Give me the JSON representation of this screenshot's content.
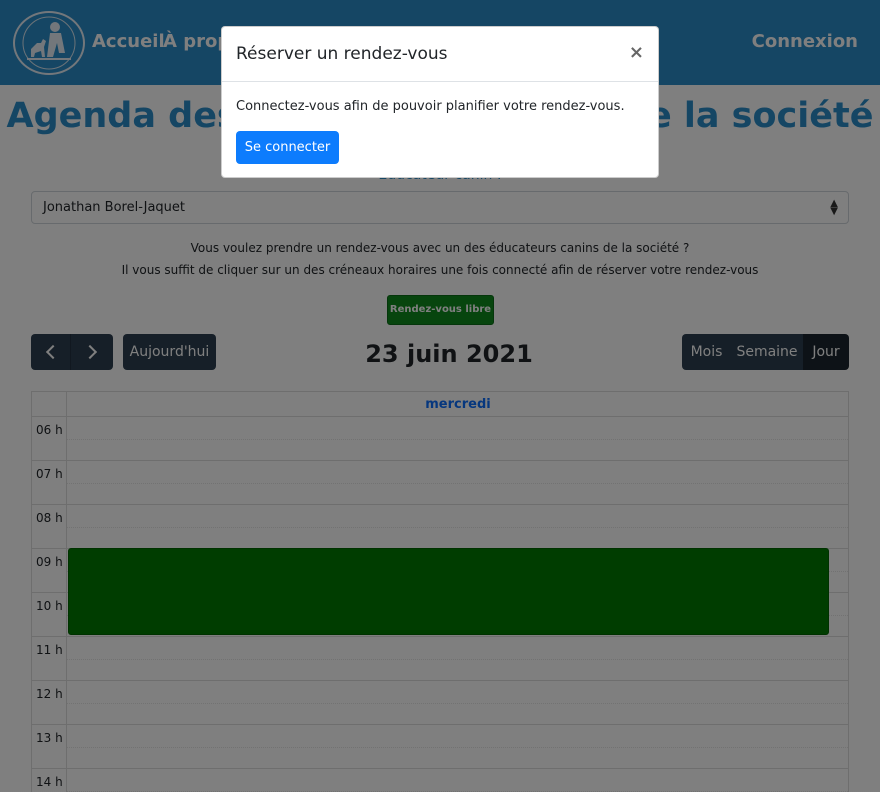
{
  "navbar": {
    "logo_icon": "dog-trainer-logo-icon",
    "links": [
      "Accueil",
      "À propos"
    ],
    "login": "Connexion"
  },
  "page": {
    "title": "Agenda des éducateurs canins de la société",
    "select_label": "Educateur canin :",
    "selected_educator": "Jonathan Borel-Jaquet",
    "info_line1": "Vous voulez prendre un rendez-vous avec un des éducateurs canins de la société ?",
    "info_line2": "Il vous suffit de cliquer sur un des créneaux horaires une fois connecté afin de réserver votre rendez-vous",
    "free_slot_button": "Rendez-vous libre"
  },
  "calendar": {
    "today_button": "Aujourd'hui",
    "title": "23 juin 2021",
    "views": [
      "Mois",
      "Semaine",
      "Jour"
    ],
    "active_view": "Jour",
    "day_name": "mercredi",
    "hours": [
      "06 h",
      "07 h",
      "08 h",
      "09 h",
      "10 h",
      "11 h",
      "12 h",
      "13 h",
      "14 h"
    ],
    "event": {
      "start": "09 h",
      "end": "11 h",
      "color": "#007a00"
    }
  },
  "modal": {
    "title": "Réserver un rendez-vous",
    "close": "×",
    "body": "Connectez-vous afin de pouvoir planifier votre rendez-vous.",
    "button": "Se connecter"
  }
}
